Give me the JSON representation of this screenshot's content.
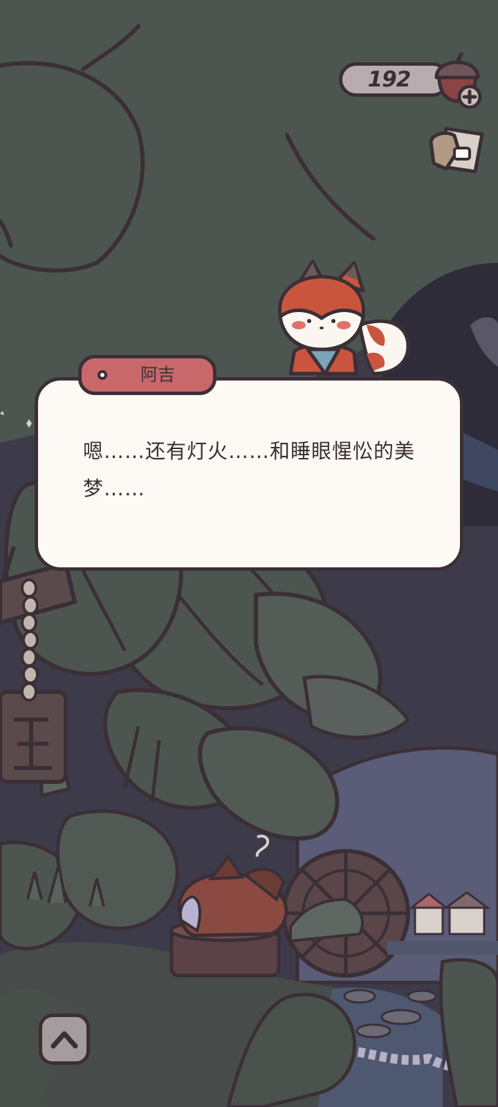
{
  "hud": {
    "currency_count": "192",
    "currency_icon": "acorn-icon",
    "collection_icon": "card-collection-icon"
  },
  "dialog": {
    "speaker_name": "阿吉",
    "text": "嗯……还有灯火……和睡眼惺忪的美梦……"
  },
  "controls": {
    "expand_icon": "chevron-up-icon"
  },
  "colors": {
    "outline": "#3b2f36",
    "dialog_bg": "#fdf9f4",
    "name_tag": "#c8686a",
    "foliage_dark": "#4d5550",
    "night_sky": "#3d3a4a",
    "fox_orange": "#c9553e"
  }
}
